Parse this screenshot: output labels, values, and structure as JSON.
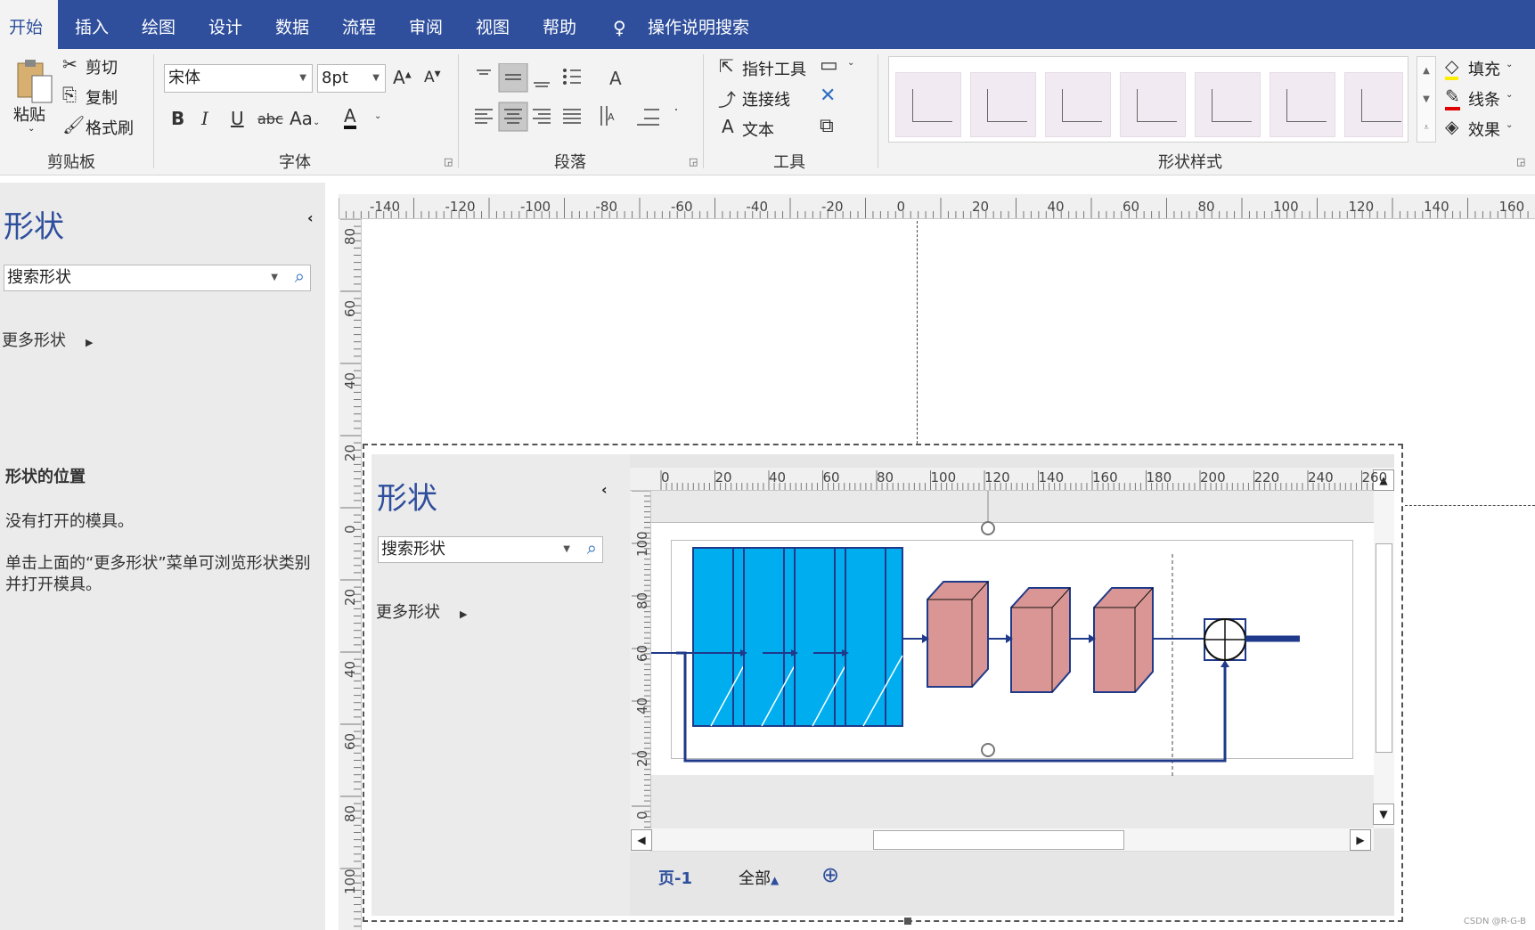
{
  "tabs": [
    "开始",
    "插入",
    "绘图",
    "设计",
    "数据",
    "流程",
    "审阅",
    "视图",
    "帮助"
  ],
  "tell_me": "操作说明搜索",
  "clipboard": {
    "paste": "粘贴",
    "cut": "剪切",
    "copy": "复制",
    "format_painter": "格式刷",
    "group": "剪贴板"
  },
  "font": {
    "name": "宋体",
    "size": "8pt",
    "group": "字体",
    "change_case": "Aa"
  },
  "paragraph": {
    "group": "段落"
  },
  "tools": {
    "pointer": "指针工具",
    "connector": "连接线",
    "text": "文本",
    "group": "工具"
  },
  "shape_styles": {
    "group": "形状样式",
    "fill": "填充",
    "line": "线条",
    "effect": "效果"
  },
  "shapes_pane": {
    "title": "形状",
    "search_placeholder": "搜索形状",
    "more_shapes": "更多形状",
    "position_heading": "形状的位置",
    "no_stencil": "没有打开的模具。",
    "hint_line1": "单击上面的“更多形状”菜单可浏览形状类别",
    "hint_line2": "并打开模具。"
  },
  "rulers": {
    "outer_h": [
      "-140",
      "-120",
      "-100",
      "-80",
      "-60",
      "-40",
      "-20",
      "0",
      "20",
      "40",
      "60",
      "80",
      "100",
      "120",
      "140",
      "160"
    ],
    "outer_v": [
      "80",
      "60",
      "40",
      "20",
      "0",
      "20",
      "40",
      "60",
      "80",
      "100"
    ],
    "inner_h": [
      "0",
      "20",
      "40",
      "60",
      "80",
      "100",
      "120",
      "140",
      "160",
      "180",
      "200",
      "220",
      "240",
      "260"
    ],
    "inner_v": [
      "100",
      "80",
      "60",
      "40",
      "20",
      "0"
    ]
  },
  "embedded": {
    "title": "形状",
    "search_placeholder": "搜索形状",
    "more_shapes": "更多形状",
    "page_tab": "页-1",
    "all_pages": "全部"
  },
  "colors": {
    "ribbon_tabs": "#2f4f9d",
    "accent": "#2f4f9d",
    "conv": "#00aeef",
    "block": "#d99694",
    "line": "#1f3a8a"
  },
  "watermark": "CSDN @R-G-B"
}
